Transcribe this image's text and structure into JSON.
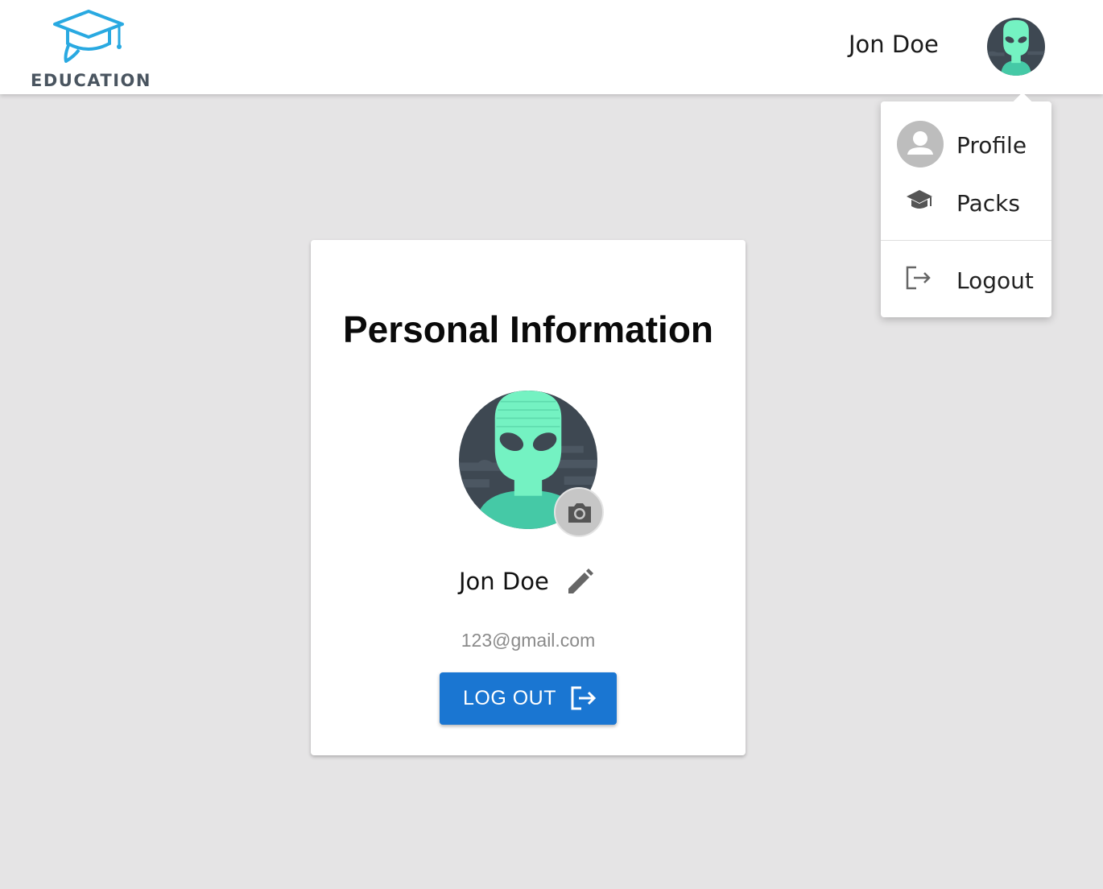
{
  "header": {
    "logo_text": "EDUCATION",
    "user_name": "Jon Doe"
  },
  "menu": {
    "items": [
      {
        "label": "Profile",
        "icon": "account-circle-icon"
      },
      {
        "label": "Packs",
        "icon": "graduation-cap-icon"
      },
      {
        "label": "Logout",
        "icon": "logout-icon"
      }
    ]
  },
  "card": {
    "title": "Personal Information",
    "name": "Jon Doe",
    "email": "123@gmail.com",
    "logout_label": "LOG OUT"
  },
  "colors": {
    "primary": "#1a76d2",
    "background": "#e5e4e5",
    "avatar_bg": "#3e4852",
    "alien_green": "#74f2c2",
    "logo_blue": "#29a9e1"
  }
}
